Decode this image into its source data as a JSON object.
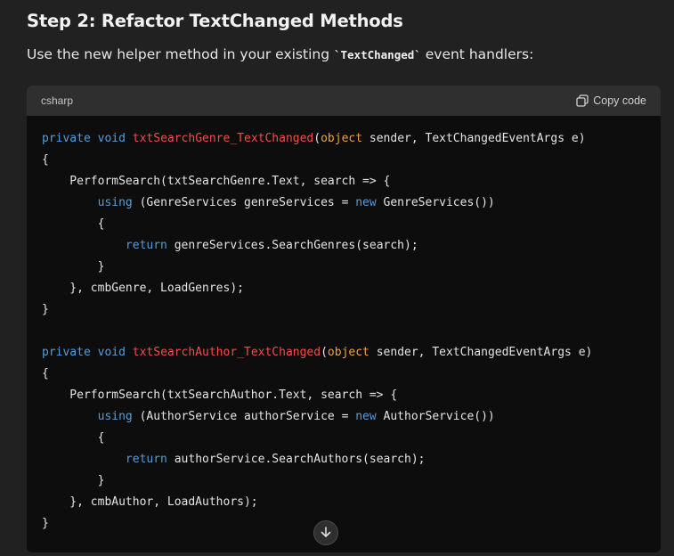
{
  "step_heading": "Step 2: Refactor TextChanged Methods",
  "intro": {
    "before": "Use the new helper method in your existing ",
    "code": "`TextChanged`",
    "after": " event handlers:"
  },
  "code_block": {
    "language": "csharp",
    "copy_label": "Copy code",
    "copy_icon": "copy-icon",
    "scroll_icon": "arrow-down-icon",
    "lines": [
      [
        {
          "t": "private",
          "c": "kw"
        },
        {
          "t": " "
        },
        {
          "t": "void",
          "c": "kw"
        },
        {
          "t": " "
        },
        {
          "t": "txtSearchGenre_TextChanged",
          "c": "fn"
        },
        {
          "t": "("
        },
        {
          "t": "object",
          "c": "ty"
        },
        {
          "t": " sender, TextChangedEventArgs e)"
        }
      ],
      [
        {
          "t": "{"
        }
      ],
      [
        {
          "t": "    PerformSearch(txtSearchGenre.Text, search => {"
        }
      ],
      [
        {
          "t": "        "
        },
        {
          "t": "using",
          "c": "kw"
        },
        {
          "t": " (GenreServices genreServices = "
        },
        {
          "t": "new",
          "c": "kw"
        },
        {
          "t": " GenreServices())"
        }
      ],
      [
        {
          "t": "        {"
        }
      ],
      [
        {
          "t": "            "
        },
        {
          "t": "return",
          "c": "kw"
        },
        {
          "t": " genreServices.SearchGenres(search);"
        }
      ],
      [
        {
          "t": "        }"
        }
      ],
      [
        {
          "t": "    }, cmbGenre, LoadGenres);"
        }
      ],
      [
        {
          "t": "}"
        }
      ],
      [
        {
          "t": ""
        }
      ],
      [
        {
          "t": "private",
          "c": "kw"
        },
        {
          "t": " "
        },
        {
          "t": "void",
          "c": "kw"
        },
        {
          "t": " "
        },
        {
          "t": "txtSearchAuthor_TextChanged",
          "c": "fn"
        },
        {
          "t": "("
        },
        {
          "t": "object",
          "c": "ty"
        },
        {
          "t": " sender, TextChangedEventArgs e)"
        }
      ],
      [
        {
          "t": "{"
        }
      ],
      [
        {
          "t": "    PerformSearch(txtSearchAuthor.Text, search => {"
        }
      ],
      [
        {
          "t": "        "
        },
        {
          "t": "using",
          "c": "kw"
        },
        {
          "t": " (AuthorService authorService = "
        },
        {
          "t": "new",
          "c": "kw"
        },
        {
          "t": " AuthorService())"
        }
      ],
      [
        {
          "t": "        {"
        }
      ],
      [
        {
          "t": "            "
        },
        {
          "t": "return",
          "c": "kw"
        },
        {
          "t": " authorService.SearchAuthors(search);"
        }
      ],
      [
        {
          "t": "        }"
        }
      ],
      [
        {
          "t": "    }, cmbAuthor, LoadAuthors);"
        }
      ],
      [
        {
          "t": "}"
        }
      ]
    ]
  },
  "colors": {
    "background": "#212121",
    "code_background": "#0d0d0d",
    "code_header": "#2f2f2f",
    "keyword": "#569cd6",
    "method_name": "#f14c4c",
    "type_keyword": "#e8a43a"
  }
}
